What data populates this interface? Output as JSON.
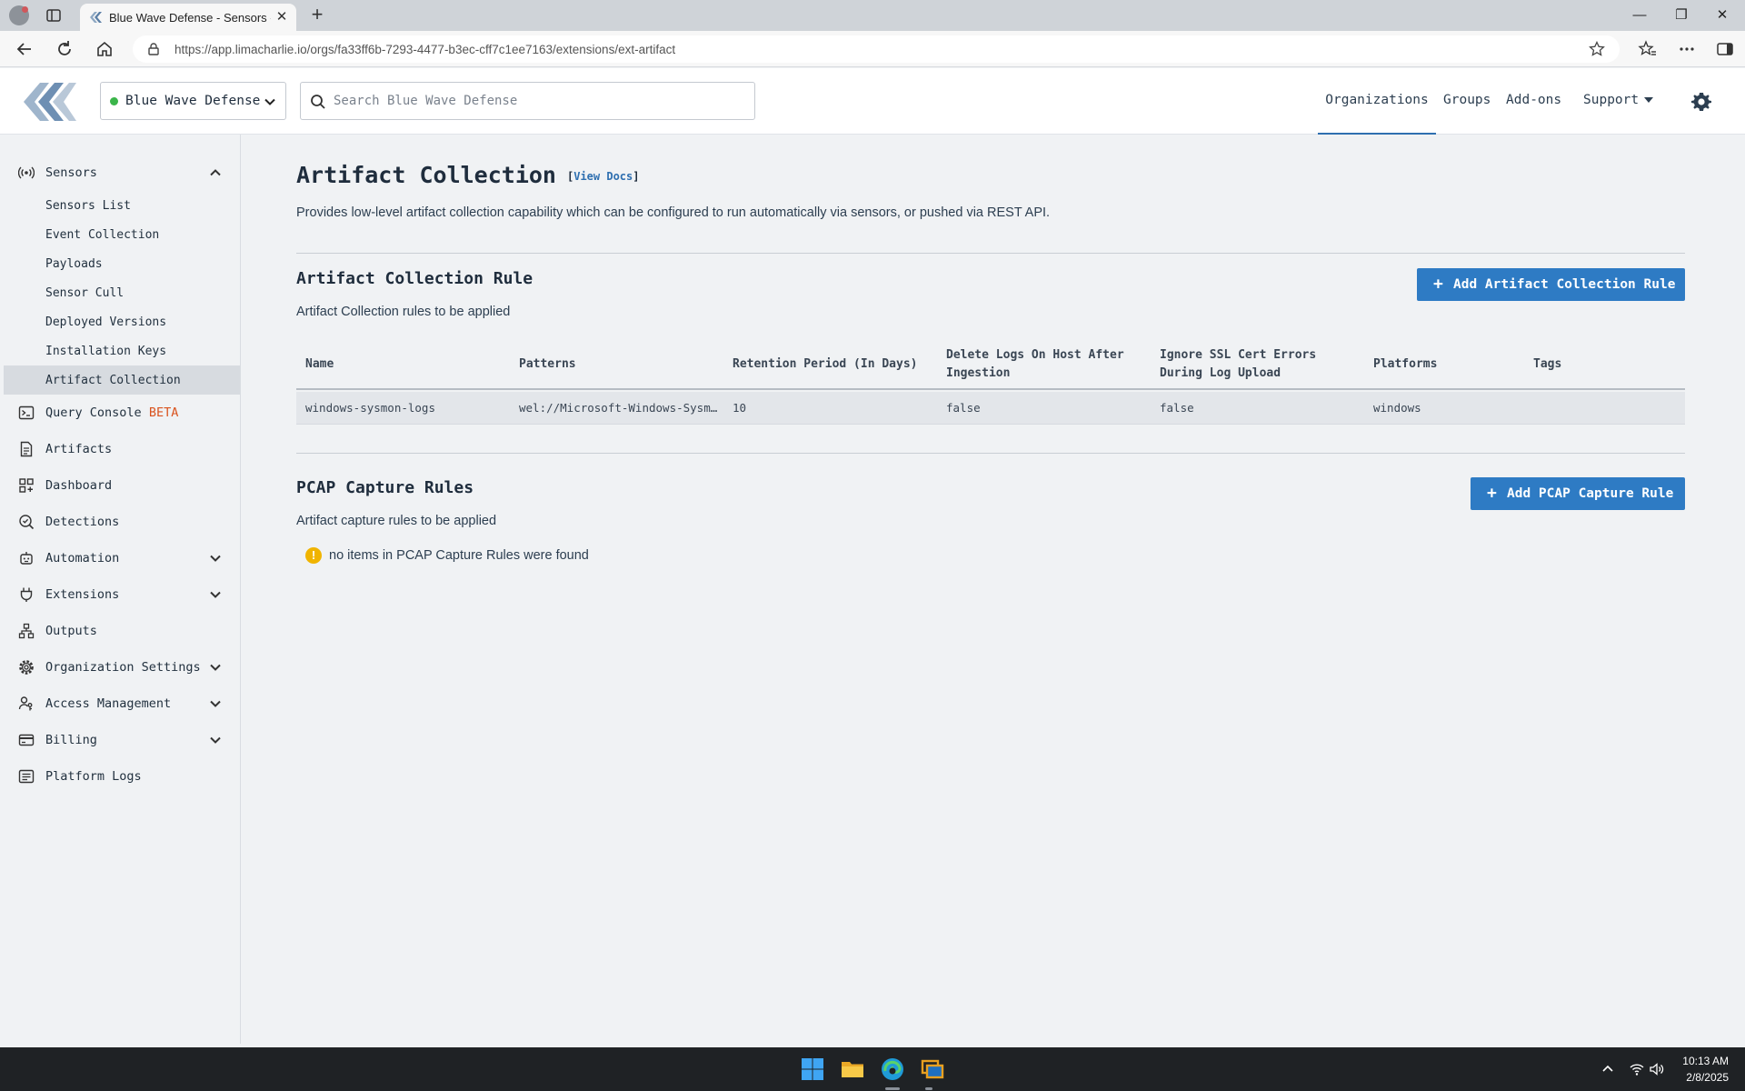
{
  "browser": {
    "tab_title": "Blue Wave Defense - Sensors - LimaCharlie",
    "url": "https://app.limacharlie.io/orgs/fa33ff6b-7293-4477-b3ec-cff7c1ee7163/extensions/ext-artifact"
  },
  "header": {
    "org_name": "Blue Wave Defense",
    "search_placeholder": "Search Blue Wave Defense",
    "nav": {
      "organizations": "Organizations",
      "groups": "Groups",
      "addons": "Add-ons",
      "support": "Support"
    },
    "accent_color": "#2e6fb0"
  },
  "sidebar": {
    "sensors": "Sensors",
    "sensors_sub": [
      "Sensors List",
      "Event Collection",
      "Payloads",
      "Sensor Cull",
      "Deployed Versions",
      "Installation Keys",
      "Artifact Collection"
    ],
    "query_console": "Query Console",
    "beta": "BETA",
    "artifacts": "Artifacts",
    "dashboard": "Dashboard",
    "detections": "Detections",
    "automation": "Automation",
    "extensions": "Extensions",
    "outputs": "Outputs",
    "org_settings": "Organization Settings",
    "access_mgmt": "Access Management",
    "billing": "Billing",
    "platform_logs": "Platform Logs"
  },
  "main": {
    "title": "Artifact Collection",
    "docs_bracket_open": "[",
    "docs_label": "View Docs",
    "docs_bracket_close": "]",
    "description": "Provides low-level artifact collection capability which can be configured to run automatically via sensors, or pushed via REST API.",
    "rule_section": {
      "title": "Artifact Collection Rule",
      "subtitle": "Artifact Collection rules to be applied",
      "add_button": "Add Artifact Collection Rule",
      "columns": [
        "Name",
        "Patterns",
        "Retention Period (In Days)",
        "Delete Logs On Host After Ingestion",
        "Ignore SSL Cert Errors During Log Upload",
        "Platforms",
        "Tags"
      ],
      "rows": [
        {
          "name": "windows-sysmon-logs",
          "patterns": "wel://Microsoft-Windows-Sysmon/Operational:*",
          "retention": "10",
          "delete_logs": "false",
          "ignore_ssl": "false",
          "platforms": "windows",
          "tags": ""
        }
      ]
    },
    "pcap_section": {
      "title": "PCAP Capture Rules",
      "subtitle": "Artifact capture rules to be applied",
      "add_button": "Add PCAP Capture Rule",
      "empty_message": "no items in PCAP Capture Rules were found"
    },
    "button_color": "#2e7bc4"
  },
  "taskbar": {
    "time": "10:13 AM",
    "date": "2/8/2025"
  }
}
